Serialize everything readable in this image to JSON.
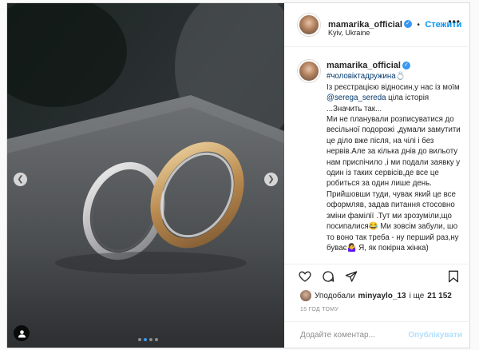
{
  "header": {
    "username": "mamarika_official",
    "follow_label": "Стежити",
    "location": "Kyiv, Ukraine",
    "separator": "•"
  },
  "caption": {
    "username": "mamarika_official",
    "hashtag": "#чоловіктадружина",
    "hashtag_emoji": "💍",
    "line1": "Із реєстрацією відносин,у нас із моїм",
    "mention": "@serega_sereda",
    "line2_rest": " ціла історія",
    "line3": "...Значить так...",
    "para1": "Ми не планували розписуватися до весільної подорожі ,думали замутити це діло вже після, на чілі і без нервів.Але за кілька днів до вильоту нам приспічило ,і ми подали заявку у один із таких сервісів,де все це робиться за один лише день.",
    "para2": "Прийшовши туди, чувак який це все оформляв, задав питання стосовно зміни фамілії .Тут ми зрозуміли,що посипалися😂 Ми зовсім забули, шо то воно так треба - ну перший раз,ну буває🤷‍♀️ Я, як покірна жінка)"
  },
  "likes": {
    "prefix": "Уподобали",
    "user": "minyaylo_13",
    "suffix": "і ще",
    "count": "21 152"
  },
  "time": "15 ГОД ТОМУ",
  "comment": {
    "placeholder": "Додайте коментар...",
    "publish_label": "Опублікувати"
  },
  "carousel": {
    "total": 4,
    "active_index": 1
  },
  "colors": {
    "accent": "#0095f6",
    "verified": "#3897f0",
    "link": "#00376b"
  }
}
